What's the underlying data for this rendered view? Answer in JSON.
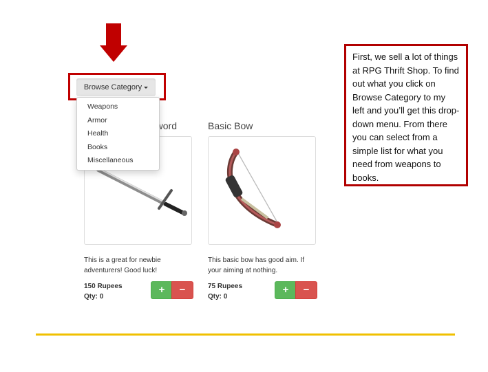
{
  "dropdown": {
    "label": "Browse Category",
    "items": [
      "Weapons",
      "Armor",
      "Health",
      "Books",
      "Miscellaneous"
    ]
  },
  "products": [
    {
      "title": "Sword",
      "title_visible_suffix": "word",
      "description": "This is a great for newbie adventurers! Good luck!",
      "price": "150 Rupees",
      "qty": "Qty: 0"
    },
    {
      "title": "Basic Bow",
      "description": "This basic bow has good aim. If your aiming at nothing.",
      "price": "75 Rupees",
      "qty": "Qty: 0"
    }
  ],
  "buttons": {
    "plus": "+",
    "minus": "−"
  },
  "callout": {
    "text": "First, we sell a lot of things at RPG Thrift Shop. To find out what you click on Browse Category to my left and you’ll get this drop-down menu. From there you can select from a simple list for what you need from weapons to books."
  },
  "colors": {
    "arrow": "#c00000",
    "accent_line": "#f0c000",
    "plus": "#5cb85c",
    "minus": "#d9534f"
  },
  "icons": [
    "down-arrow-icon",
    "caret-down-icon",
    "sword-icon",
    "bow-icon"
  ]
}
